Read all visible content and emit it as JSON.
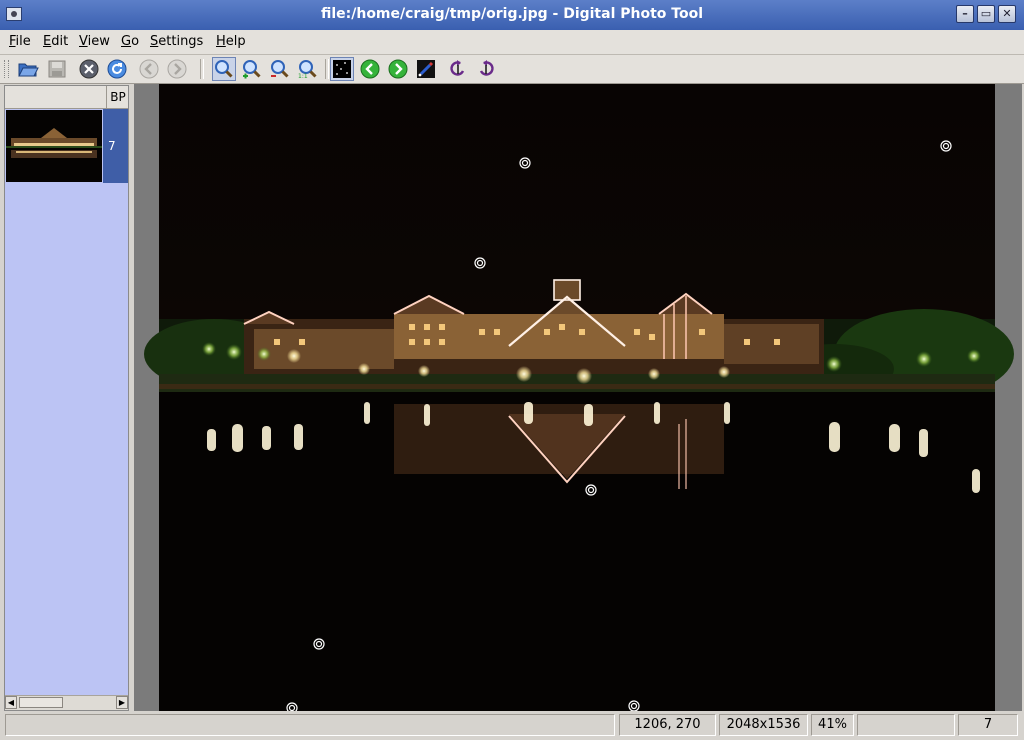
{
  "window": {
    "title": "file:/home/craig/tmp/orig.jpg - Digital Photo Tool"
  },
  "menu": [
    {
      "accel": "F",
      "rest": "ile"
    },
    {
      "accel": "E",
      "rest": "dit"
    },
    {
      "accel": "V",
      "rest": "iew"
    },
    {
      "accel": "G",
      "rest": "o"
    },
    {
      "accel": "S",
      "rest": "ettings"
    },
    {
      "accel": "H",
      "rest": "elp"
    }
  ],
  "toolbar": {
    "icons": [
      "open-folder-icon",
      "save-icon",
      "close-icon",
      "reload-icon",
      "back-icon",
      "forward-icon",
      "zoom-fit-icon",
      "zoom-in-icon",
      "zoom-out-icon",
      "zoom-original-icon",
      "bad-pixel-icon",
      "previous-icon",
      "next-icon",
      "edit-icon",
      "rotate-left-icon",
      "rotate-right-icon"
    ]
  },
  "panel": {
    "column_header": "BP",
    "thumbnails": [
      {
        "count": "7"
      }
    ]
  },
  "status": {
    "message": "",
    "coordinates": "1206, 270",
    "dimensions": "2048x1536",
    "zoom": "41%",
    "extra": "",
    "count": "7"
  },
  "colors": {
    "accent": "#3f5ea7",
    "panel": "#bcc4f4",
    "titlebar": "#4a6dbd"
  }
}
